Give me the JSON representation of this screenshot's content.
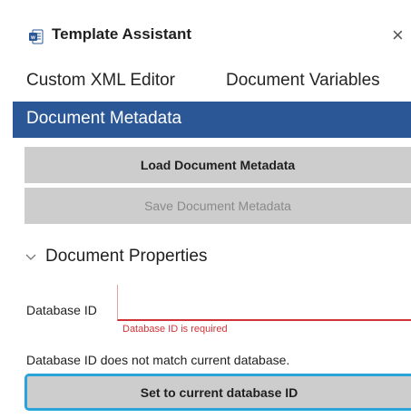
{
  "header": {
    "title": "Template Assistant",
    "app_icon": "word-document-icon",
    "close_glyph": "×"
  },
  "tabs": [
    {
      "label": "Custom XML Editor"
    },
    {
      "label": "Document Variables"
    },
    {
      "label": "Document Metadata",
      "active": true
    }
  ],
  "actions": {
    "load_label": "Load Document Metadata",
    "save_label": "Save Document Metadata"
  },
  "section": {
    "label": "Document Properties",
    "expanded": true
  },
  "form": {
    "database_id_label": "Database ID",
    "database_id_value": "",
    "database_id_error": "Database ID is required",
    "mismatch_message": "Database ID does not match current database.",
    "set_button_label": "Set to current database ID"
  },
  "colors": {
    "accent": "#2b5797",
    "error": "#d13438",
    "focus": "#2aa4d8",
    "button_bg": "#cdcdcd"
  }
}
